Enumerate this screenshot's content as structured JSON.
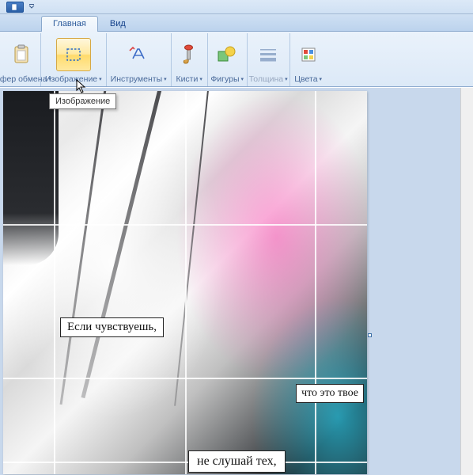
{
  "tabs": {
    "main": "Главная",
    "view": "Вид"
  },
  "ribbon": {
    "clipboard": {
      "label": "Буфер обмена"
    },
    "image": {
      "label": "Изображение"
    },
    "tools": {
      "label": "Инструменты"
    },
    "brushes": {
      "label": "Кисти"
    },
    "shapes": {
      "label": "Фигуры"
    },
    "thickness": {
      "label": "Толщина"
    },
    "colors": {
      "label": "Цвета"
    }
  },
  "tooltip": {
    "image": "Изображение"
  },
  "canvas": {
    "captions": {
      "c1": "Если чувствуешь,",
      "c2": "что это твое",
      "c3": "не слушай тех,"
    }
  }
}
